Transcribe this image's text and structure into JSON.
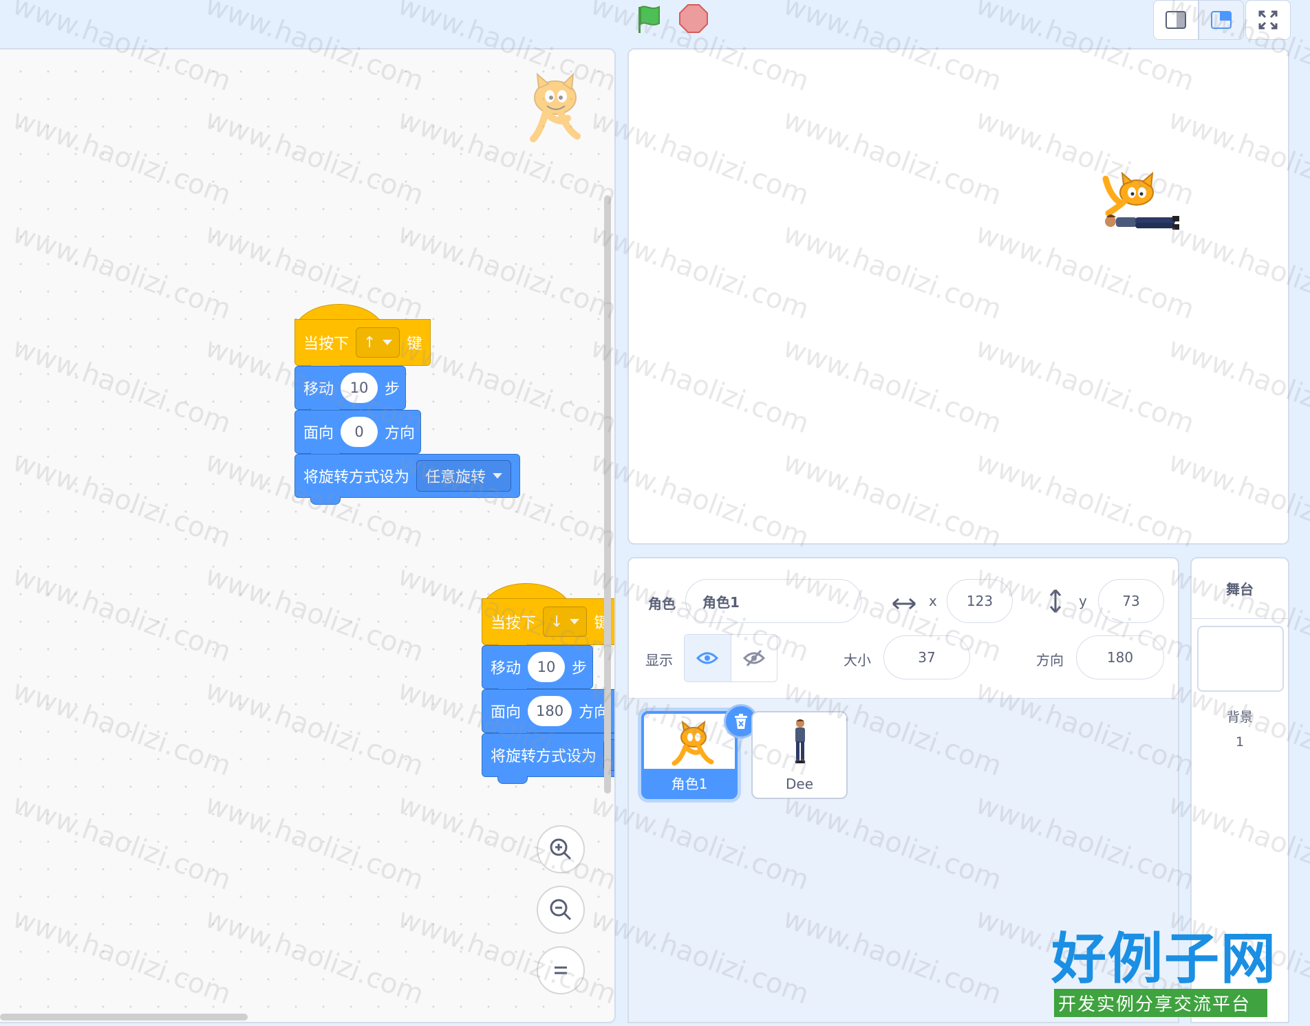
{
  "controls": {
    "green_flag": "green-flag-icon",
    "stop": "stop-sign-icon",
    "layout_modes": [
      "small-stage-icon",
      "normal-stage-icon"
    ],
    "fullscreen": "fullscreen-icon"
  },
  "scripts": [
    {
      "hat": {
        "prefix": "当按下",
        "key": "↑",
        "suffix": "键"
      },
      "move": {
        "label": "移动",
        "value": "10",
        "suffix": "步"
      },
      "point": {
        "label": "面向",
        "value": "0",
        "suffix": "方向"
      },
      "rotation": {
        "label": "将旋转方式设为",
        "style": "任意旋转"
      }
    },
    {
      "hat": {
        "prefix": "当按下",
        "key": "↓",
        "suffix": "键"
      },
      "move": {
        "label": "移动",
        "value": "10",
        "suffix": "步"
      },
      "point": {
        "label": "面向",
        "value": "180",
        "suffix": "方向"
      },
      "rotation": {
        "label": "将旋转方式设为"
      }
    }
  ],
  "sprite_info": {
    "sprite_label": "角色",
    "sprite_name": "角色1",
    "x_label": "x",
    "x_value": "123",
    "y_label": "y",
    "y_value": "73",
    "show_label": "显示",
    "size_label": "大小",
    "size_value": "37",
    "direction_label": "方向",
    "direction_value": "180"
  },
  "sprites": [
    {
      "name": "角色1",
      "selected": true
    },
    {
      "name": "Dee",
      "selected": false
    }
  ],
  "stage_panel": {
    "title": "舞台",
    "backdrop_label": "背景",
    "backdrop_count": "1"
  },
  "watermark": "www.haolizi.com",
  "logo": {
    "title": "好例子网",
    "subtitle": "开发实例分享交流平台"
  },
  "colors": {
    "events": "#ffbf00",
    "motion": "#4c97ff",
    "background": "#e5f0ff"
  }
}
